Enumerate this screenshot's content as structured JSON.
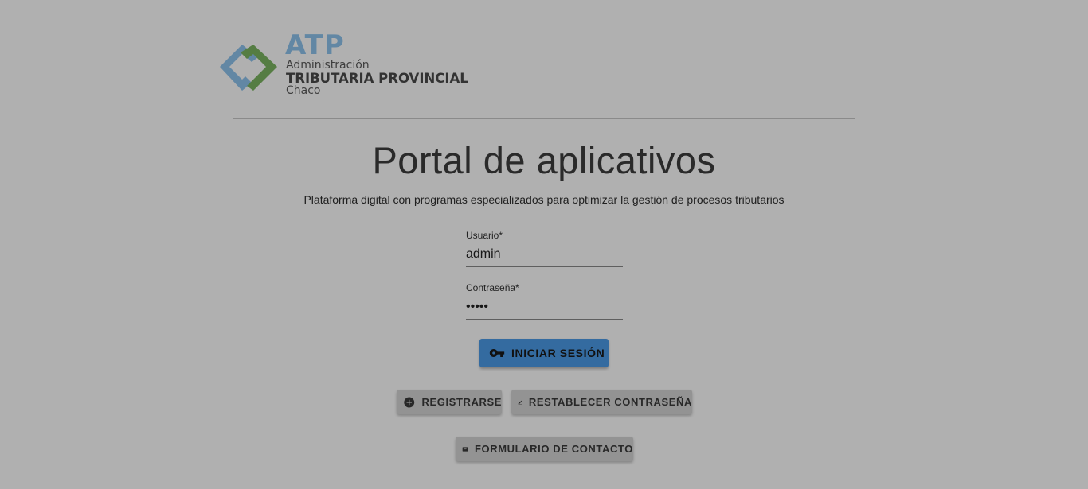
{
  "logo": {
    "acronym": "ATP",
    "line1": "Administración",
    "line2": "TRIBUTARIA PROVINCIAL",
    "line3": "Chaco",
    "colors": {
      "blue": "#8fc4ee",
      "green": "#7bb662"
    }
  },
  "header": {
    "title": "Portal de aplicativos",
    "subtitle": "Plataforma digital con programas especializados para optimizar la gestión de procesos tributarios"
  },
  "form": {
    "user": {
      "label": "Usuario*",
      "value": "admin"
    },
    "password": {
      "label": "Contraseña*",
      "value": "•••••"
    },
    "login_label": "INICIAR SESIÓN",
    "login_icon": "key-icon"
  },
  "actions": {
    "register": {
      "label": "REGISTRARSE",
      "icon": "add-circle-icon"
    },
    "reset": {
      "label": "RESTABLECER CONTRASEÑA",
      "icon": "pencil-icon"
    },
    "contact": {
      "label": "FORMULARIO DE CONTACTO",
      "icon": "mail-icon"
    }
  },
  "colors": {
    "primary": "#4c9be8",
    "secondary": "#d6d6d6",
    "overlay": "rgba(0,0,0,0.31)"
  }
}
